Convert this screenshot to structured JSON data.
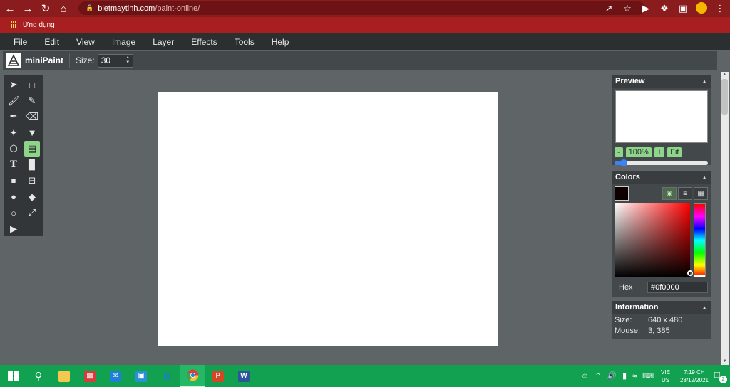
{
  "browser": {
    "url_host": "bietmaytinh.com",
    "url_path": "/paint-online/",
    "bookmark_label": "Ứng dụng",
    "colors": {
      "frame": "#8b1c1e",
      "bookmarks": "#a71f21"
    }
  },
  "app": {
    "menu": [
      "File",
      "Edit",
      "View",
      "Image",
      "Layer",
      "Effects",
      "Tools",
      "Help"
    ],
    "logo_text": "miniPaint",
    "toolbar": {
      "size_label": "Size:",
      "size_value": "30"
    },
    "tools": [
      "select-icon",
      "rectangle-select-icon",
      "brush-icon",
      "pencil-icon",
      "eyedropper-icon",
      "eraser-icon",
      "magic-wand-icon",
      "fill-bucket-icon",
      "shape-icon",
      "image-icon",
      "text-icon",
      "gradient-icon",
      "stamp-icon",
      "crop-icon",
      "blur-icon",
      "sharpen-icon",
      "bulge-icon",
      "resize-icon",
      "animation-icon"
    ],
    "active_tool": "image-icon",
    "canvas_color": "#ffffff",
    "preview": {
      "title": "Preview",
      "zoom_minus": "-",
      "zoom_value": "100%",
      "zoom_plus": "+",
      "zoom_fit": "Fit",
      "zoom_slider": 0.07
    },
    "colors": {
      "title": "Colors",
      "current_color": "#0f0000",
      "hex_label": "Hex",
      "hex_value": "#0f0000",
      "accent": "#8fd48b"
    },
    "information": {
      "title": "Information",
      "size_label": "Size:",
      "size_value": "640 x 480",
      "mouse_label": "Mouse:",
      "mouse_value": "3, 385"
    }
  },
  "taskbar": {
    "apps": [
      "windows-start-icon",
      "search-icon",
      "file-explorer-icon",
      "gift-icon",
      "mail-icon",
      "store-icon",
      "edge-icon",
      "chrome-icon",
      "powerpoint-icon",
      "word-icon"
    ],
    "active_app": "chrome-icon",
    "lang_top": "VIE",
    "lang_bottom": "US",
    "time": "7:19 CH",
    "date": "28/12/2021",
    "notification_count": "2",
    "color": "#12a150"
  }
}
